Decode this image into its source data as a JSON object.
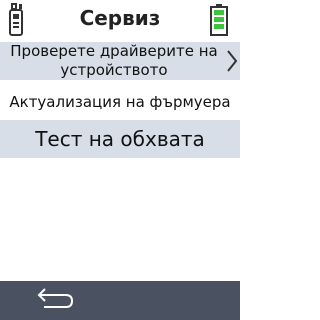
{
  "header": {
    "title": "Сервиз",
    "left_icon": "device-remote-icon",
    "right_icon": "battery-full-icon",
    "battery_color": "#3cc43c"
  },
  "menu": {
    "items": [
      {
        "label_line1": "Проверете драйверите на",
        "label_line2": "устройството",
        "icon": "chevron-right-icon"
      },
      {
        "label": "Актуализация на фърмуера"
      },
      {
        "label": "Тест на обхвата"
      }
    ]
  },
  "footer": {
    "back_icon": "back-arrow-icon",
    "background": "#4a5160"
  },
  "colors": {
    "item_highlight": "#d7dee8"
  }
}
